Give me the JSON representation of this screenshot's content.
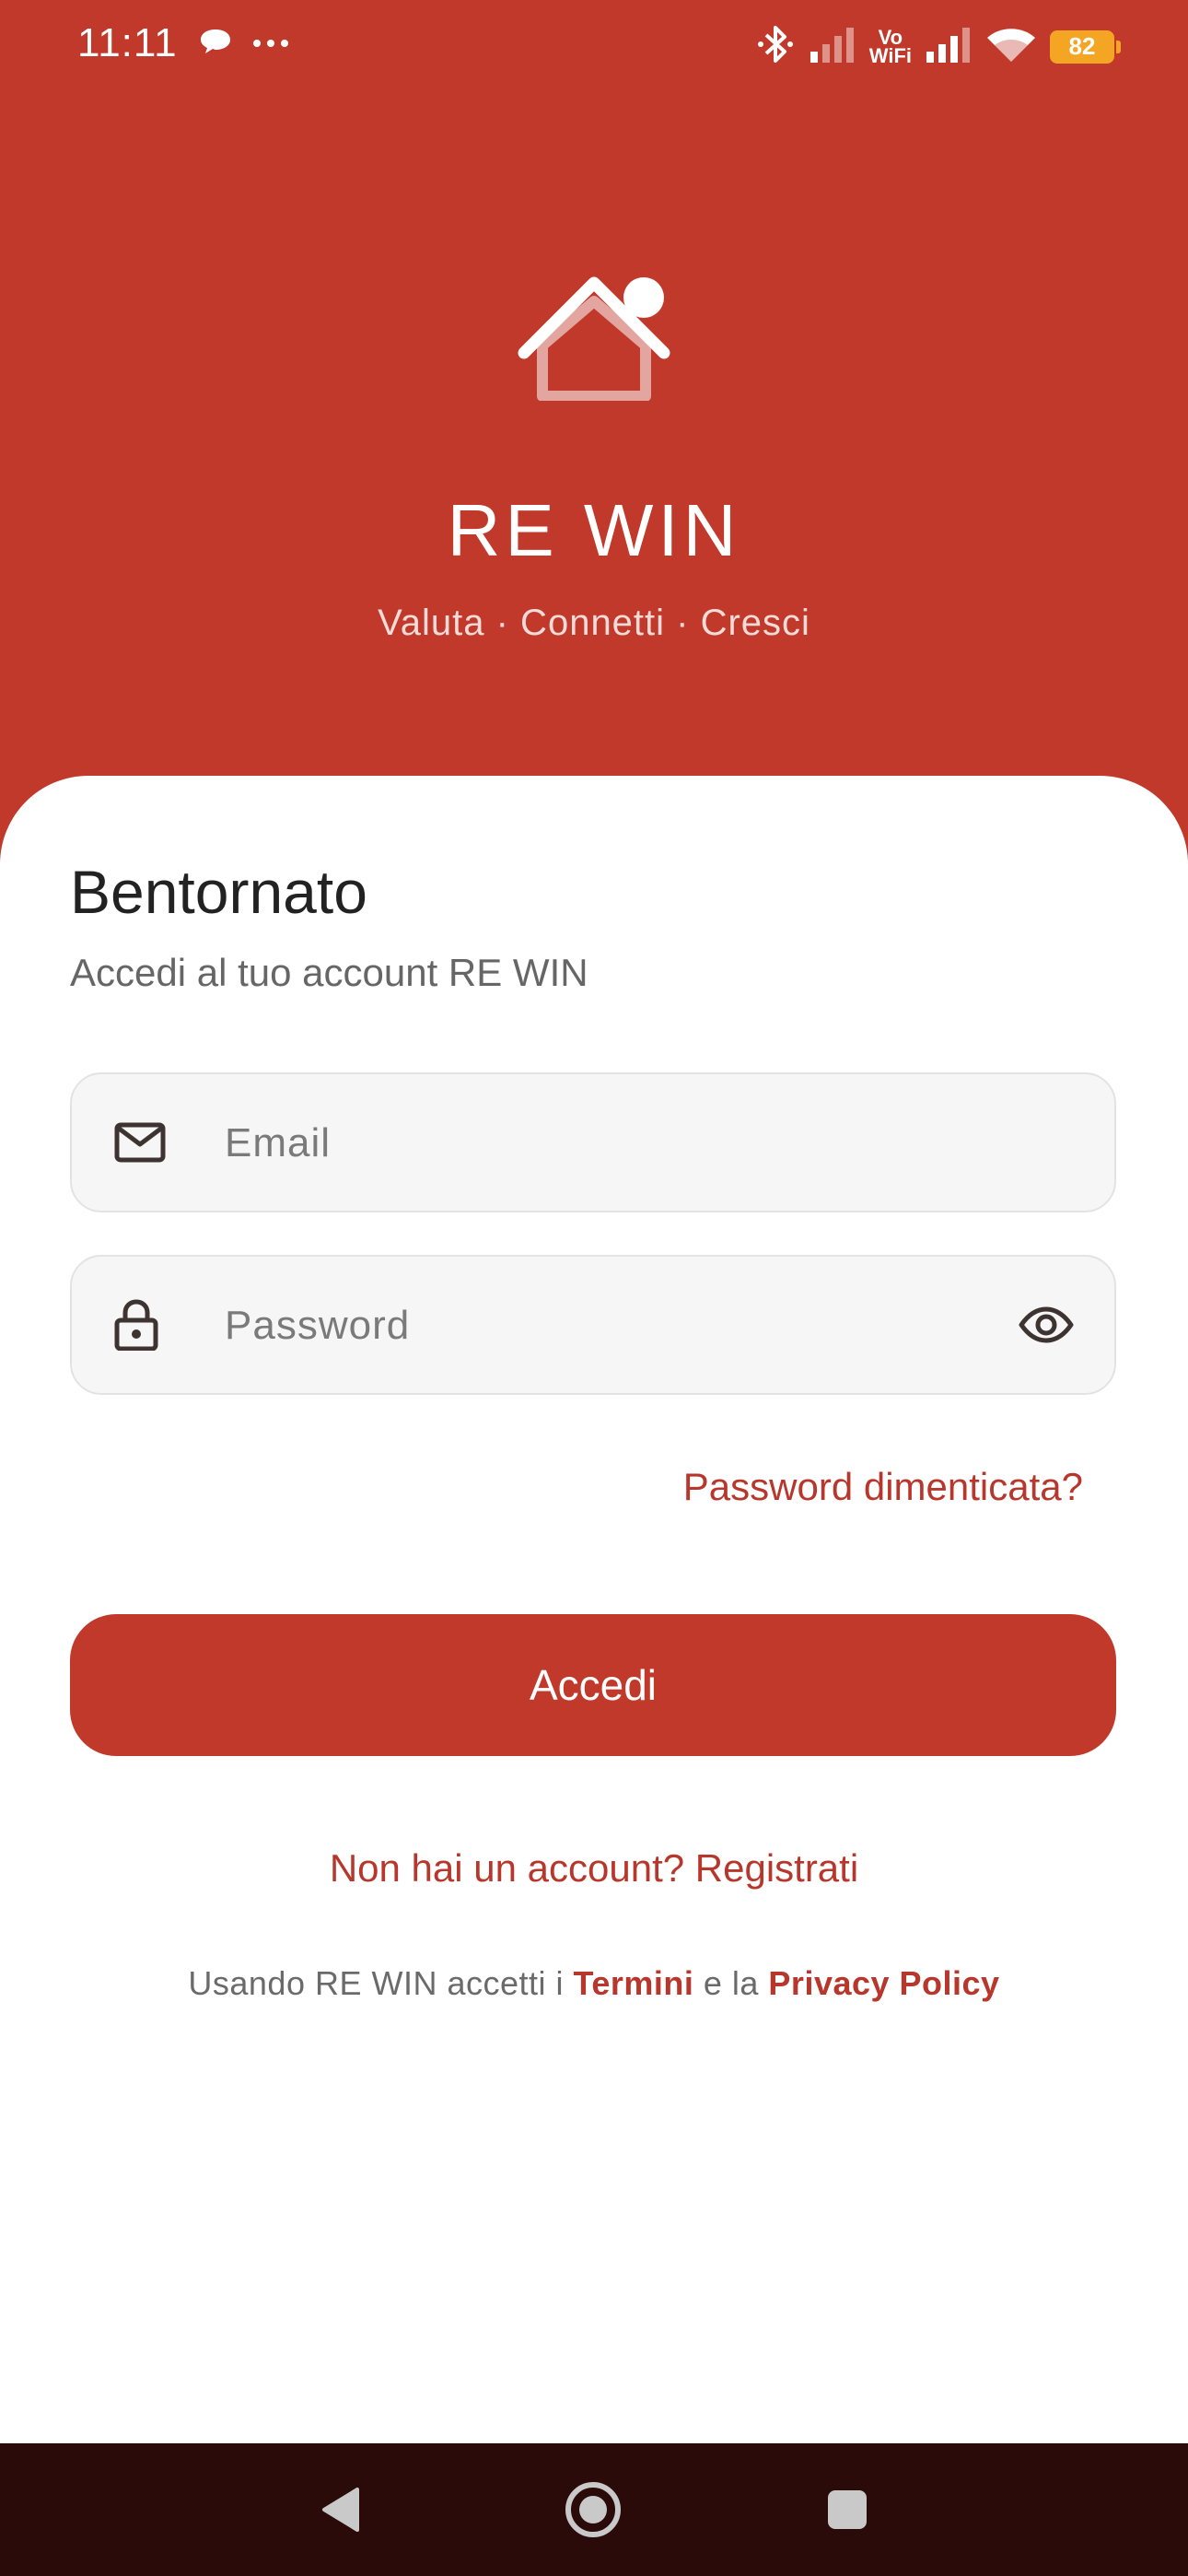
{
  "status_bar": {
    "time": "11:11",
    "message_icon": "chat-bubble-icon",
    "more_icon": "more-dots-icon",
    "bluetooth_icon": "bluetooth-icon",
    "vowifi_top": "Vo",
    "vowifi_bottom": "WiFi",
    "battery_level": "82"
  },
  "hero": {
    "logo_icon": "house-icon",
    "title": "RE WIN",
    "tagline": "Valuta · Connetti · Cresci"
  },
  "login": {
    "title": "Bentornato",
    "subtitle": "Accedi al tuo account RE WIN",
    "email": {
      "placeholder": "Email",
      "value": "",
      "icon": "mail-icon"
    },
    "password": {
      "placeholder": "Password",
      "value": "",
      "icon": "lock-icon",
      "toggle_icon": "eye-icon"
    },
    "forgot_label": "Password dimenticata?",
    "submit_label": "Accedi",
    "register_label": "Non hai un account? Registrati",
    "terms": {
      "prefix": "Usando RE WIN accetti i ",
      "terms_link": "Termini",
      "middle": " e la ",
      "privacy_link": "Privacy Policy"
    }
  },
  "colors": {
    "brand": "#c1392b",
    "link": "#b8372c",
    "nav_bar": "#2a0b09",
    "battery": "#f5a524"
  }
}
